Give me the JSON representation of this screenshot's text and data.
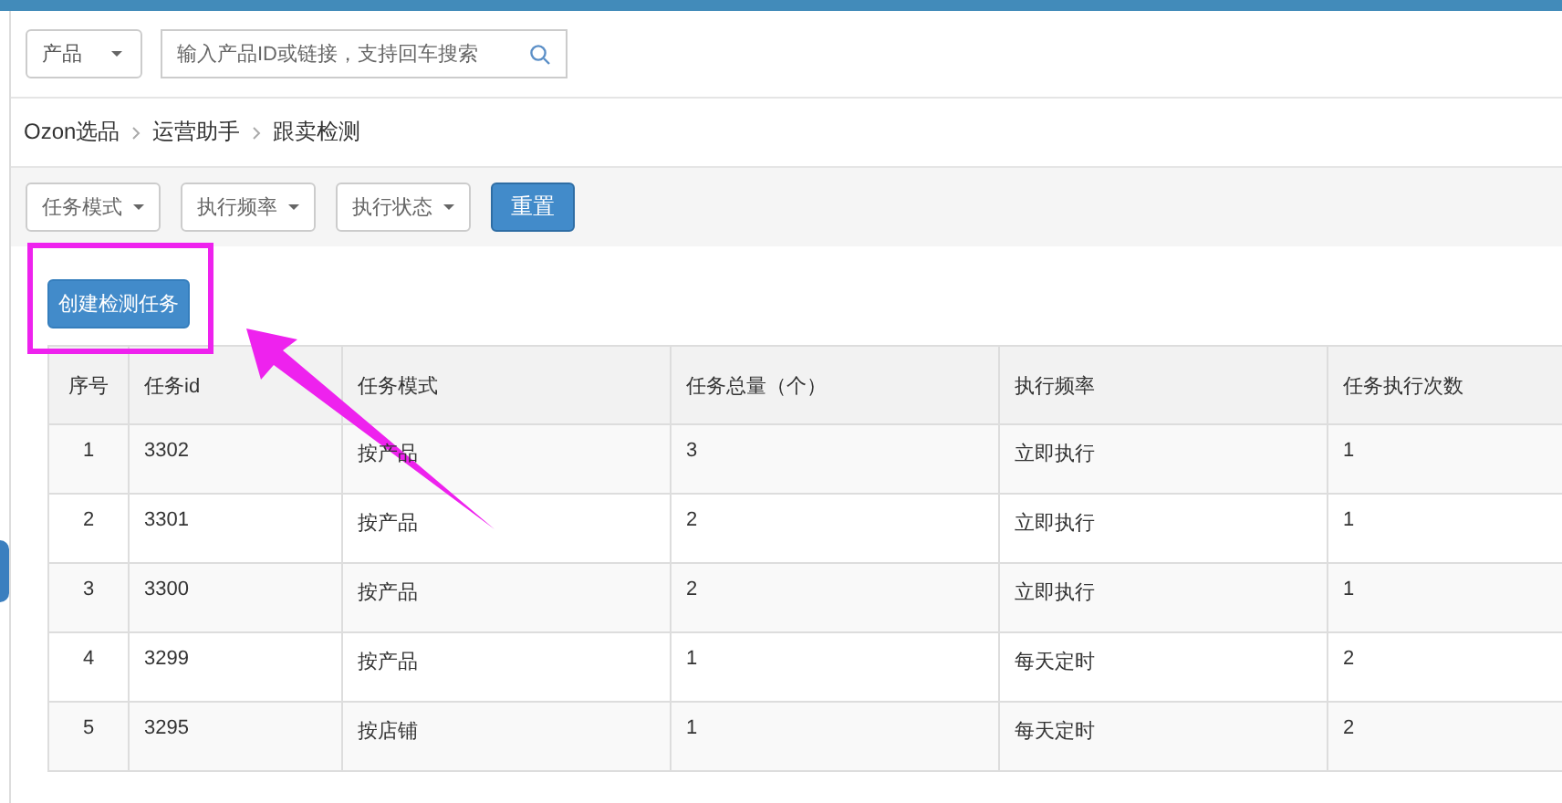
{
  "search": {
    "scope": "产品",
    "placeholder": "输入产品ID或链接，支持回车搜索"
  },
  "breadcrumb": [
    "Ozon选品",
    "运营助手",
    "跟卖检测"
  ],
  "filters": [
    "任务模式",
    "执行频率",
    "执行状态"
  ],
  "reset_button": "重置",
  "create_button": "创建检测任务",
  "table": {
    "columns": [
      "序号",
      "任务id",
      "任务模式",
      "任务总量（个）",
      "执行频率",
      "任务执行次数"
    ],
    "rows": [
      [
        "1",
        "3302",
        "按产品",
        "3",
        "立即执行",
        "1"
      ],
      [
        "2",
        "3301",
        "按产品",
        "2",
        "立即执行",
        "1"
      ],
      [
        "3",
        "3300",
        "按产品",
        "2",
        "立即执行",
        "1"
      ],
      [
        "4",
        "3299",
        "按产品",
        "1",
        "每天定时",
        "2"
      ],
      [
        "5",
        "3295",
        "按店铺",
        "1",
        "每天定时",
        "2"
      ]
    ]
  }
}
